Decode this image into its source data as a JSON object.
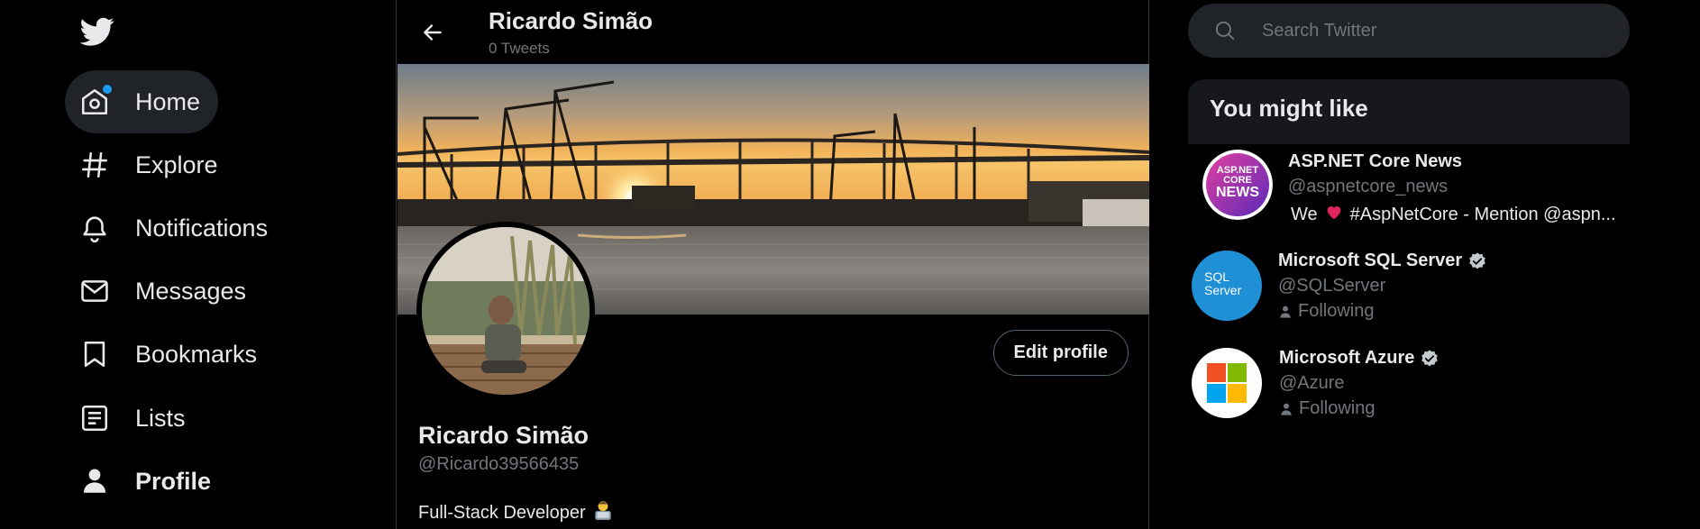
{
  "colors": {
    "accent": "#1d9bf0",
    "background": "#000000",
    "text": "#e7e9ea",
    "muted": "#71767b",
    "active_bg": "#202327",
    "panel_bg": "#16181c"
  },
  "sidebar": {
    "logo_icon": "twitter-bird-icon",
    "items": [
      {
        "label": "Home",
        "icon": "home-icon",
        "active": true,
        "notification_dot": true
      },
      {
        "label": "Explore",
        "icon": "hashtag-icon"
      },
      {
        "label": "Notifications",
        "icon": "bell-icon"
      },
      {
        "label": "Messages",
        "icon": "envelope-icon"
      },
      {
        "label": "Bookmarks",
        "icon": "bookmark-icon"
      },
      {
        "label": "Lists",
        "icon": "list-icon"
      },
      {
        "label": "Profile",
        "icon": "person-icon",
        "bold": true
      }
    ]
  },
  "header": {
    "title": "Ricardo Simão",
    "subtitle": "0 Tweets"
  },
  "profile": {
    "name": "Ricardo Simão",
    "handle": "@Ricardo39566435",
    "bio": "Full-Stack Developer",
    "bio_emoji": "technologist-emoji",
    "edit_button": "Edit profile"
  },
  "search": {
    "placeholder": "Search Twitter"
  },
  "suggestions": {
    "title": "You might like",
    "items": [
      {
        "name": "ASP.NET Core News",
        "handle": "@aspnetcore_news",
        "desc_prefix": "We",
        "desc_suffix": "#AspNetCore - Mention @aspn...",
        "avatar_lines": [
          "ASP.NET",
          "CORE",
          "NEWS"
        ]
      },
      {
        "name": "Microsoft SQL Server",
        "handle": "@SQLServer",
        "status": "Following",
        "verified": true,
        "avatar_lines": [
          "SQL",
          "Server"
        ]
      },
      {
        "name": "Microsoft Azure",
        "handle": "@Azure",
        "status": "Following",
        "verified": true
      }
    ]
  }
}
